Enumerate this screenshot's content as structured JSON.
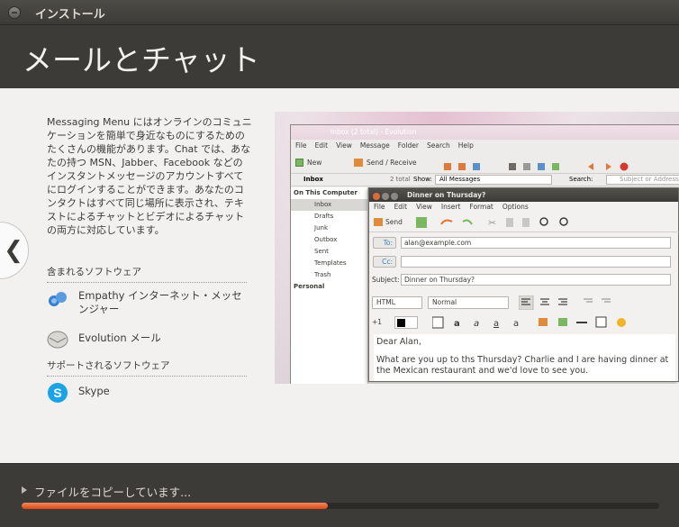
{
  "window": {
    "title": "インストール"
  },
  "page": {
    "title": "メールとチャット"
  },
  "description": "Messaging Menu にはオンラインのコミュニケーションを簡単で身近なものにするためのたくさんの機能があります。Chat では、あなたの持つ MSN、Jabber、Facebook などのインスタントメッセージのアカウントすべてにログインすることができます。あなたのコンタクトはすべて同じ場所に表示され、テキストによるチャットとビデオによるチャットの両方に対応しています。",
  "included": {
    "header": "含まれるソフトウェア",
    "apps": [
      {
        "name": "Empathy インターネット・メッセンジャー",
        "icon": "empathy-icon"
      },
      {
        "name": "Evolution メール",
        "icon": "evolution-icon"
      }
    ]
  },
  "supported": {
    "header": "サポートされるソフトウェア",
    "apps": [
      {
        "name": "Skype",
        "icon": "skype-icon"
      }
    ]
  },
  "nav": {
    "prev": "❮",
    "next": "❯"
  },
  "screenshot": {
    "evo_title": "Inbox (2 total) - Evolution",
    "evo_menu": [
      "File",
      "Edit",
      "View",
      "Message",
      "Folder",
      "Search",
      "Help"
    ],
    "evo_new": "New",
    "evo_send_receive": "Send / Receive",
    "folder_header": "Inbox",
    "total": "2 total",
    "show_label": "Show:",
    "show_value": "All Messages",
    "search_label": "Search:",
    "search_placeholder": "Subject or Addresses",
    "folders": [
      "On This Computer",
      "Inbox",
      "Drafts",
      "Junk",
      "Outbox",
      "Sent",
      "Templates",
      "Trash",
      "Personal"
    ],
    "dlg_title": "Dinner on Thursday?",
    "dlg_menu": [
      "File",
      "Edit",
      "View",
      "Insert",
      "Format",
      "Options"
    ],
    "send": "Send",
    "to_label": "To:",
    "to_value": "alan@example.com",
    "cc_label": "Cc:",
    "subject_label": "Subject:",
    "subject_value": "Dinner on Thursday?",
    "format_html": "HTML",
    "format_normal": "Normal",
    "font_size": "+1",
    "body_line1": "Dear Alan,",
    "body_line2": "What are you up to ths Thursday? Charlie and I are having dinner at the Mexican restaurant and we'd love to see you."
  },
  "progress": {
    "label": "ファイルをコピーしています...",
    "fraction": 0.48
  },
  "colors": {
    "accent": "#dd4814",
    "dark": "#3c3b37",
    "panel": "#f2f1f0"
  }
}
